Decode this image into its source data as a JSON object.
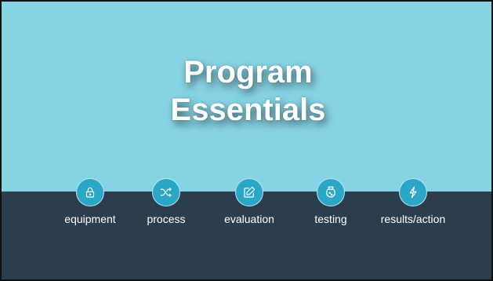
{
  "slide": {
    "title_line1": "Program",
    "title_line2": "Essentials",
    "colors": {
      "top_band": "#86d3e3",
      "bottom_band": "#2c3d4e",
      "icon_circle": "#2aa7c6",
      "text": "#ffffff"
    },
    "items": [
      {
        "label": "equipment",
        "icon": "lock-icon"
      },
      {
        "label": "process",
        "icon": "shuffle-icon"
      },
      {
        "label": "evaluation",
        "icon": "edit-icon"
      },
      {
        "label": "testing",
        "icon": "flask-icon"
      },
      {
        "label": "results/action",
        "icon": "lightning-icon"
      }
    ]
  }
}
